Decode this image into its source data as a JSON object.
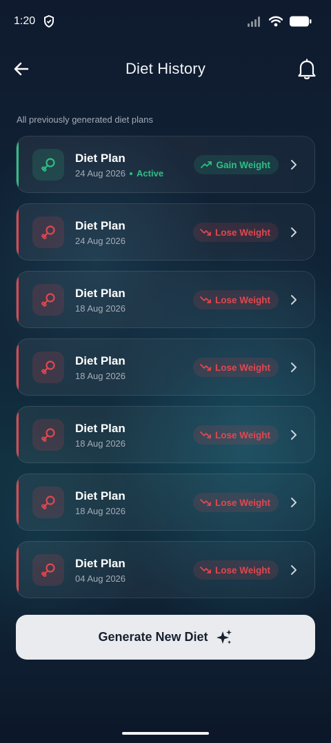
{
  "status": {
    "time": "1:20"
  },
  "header": {
    "title": "Diet History"
  },
  "subtitle": "All previously generated diet plans",
  "colors": {
    "gain": "#2fbf85",
    "lose": "#e2474f"
  },
  "plans": [
    {
      "title": "Diet Plan",
      "date": "24 Aug 2026",
      "active_label": "Active",
      "goal": "Gain Weight",
      "type": "gain"
    },
    {
      "title": "Diet Plan",
      "date": "24 Aug 2026",
      "goal": "Lose Weight",
      "type": "lose"
    },
    {
      "title": "Diet Plan",
      "date": "18 Aug 2026",
      "goal": "Lose Weight",
      "type": "lose"
    },
    {
      "title": "Diet Plan",
      "date": "18 Aug 2026",
      "goal": "Lose Weight",
      "type": "lose"
    },
    {
      "title": "Diet Plan",
      "date": "18 Aug 2026",
      "goal": "Lose Weight",
      "type": "lose"
    },
    {
      "title": "Diet Plan",
      "date": "18 Aug 2026",
      "goal": "Lose Weight",
      "type": "lose"
    },
    {
      "title": "Diet Plan",
      "date": "04 Aug 2026",
      "goal": "Lose Weight",
      "type": "lose"
    }
  ],
  "actions": {
    "generate_label": "Generate New Diet"
  }
}
